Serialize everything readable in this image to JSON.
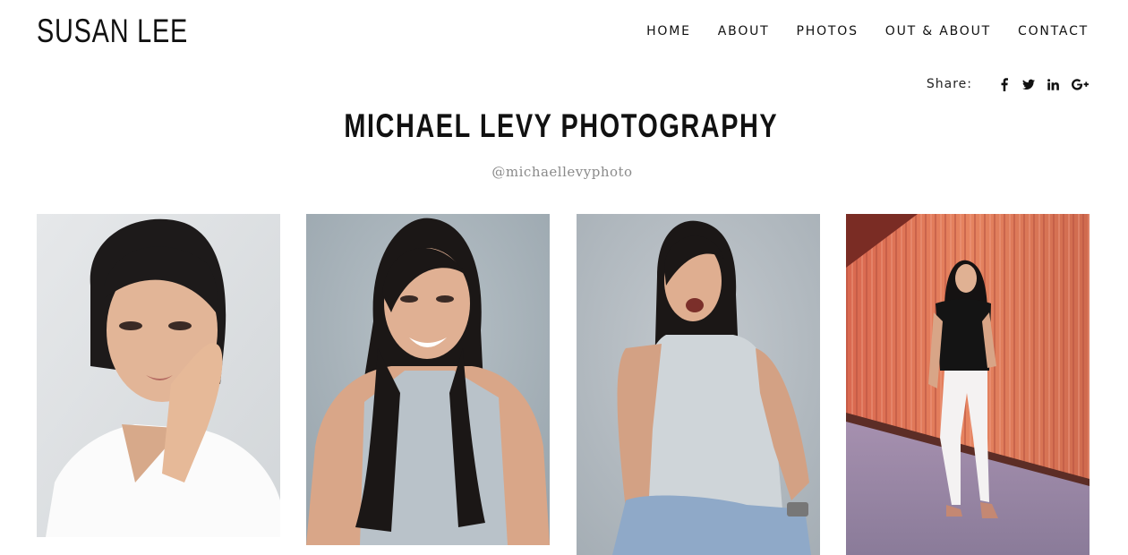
{
  "site": {
    "logo": "SUSAN LEE"
  },
  "nav": {
    "items": [
      {
        "label": "HOME"
      },
      {
        "label": "ABOUT"
      },
      {
        "label": "PHOTOS"
      },
      {
        "label": "OUT & ABOUT"
      },
      {
        "label": "CONTACT"
      }
    ]
  },
  "share": {
    "label": "Share:",
    "icons": [
      "facebook-icon",
      "twitter-icon",
      "linkedin-icon",
      "google-plus-icon"
    ]
  },
  "page": {
    "title": "MICHAEL LEVY PHOTOGRAPHY",
    "handle": "@michaellevyphoto"
  },
  "gallery": {
    "photos": [
      {
        "name": "headshot-white-tee"
      },
      {
        "name": "headshot-gray-tank"
      },
      {
        "name": "laughing-seated"
      },
      {
        "name": "full-length-red-wall"
      }
    ]
  }
}
